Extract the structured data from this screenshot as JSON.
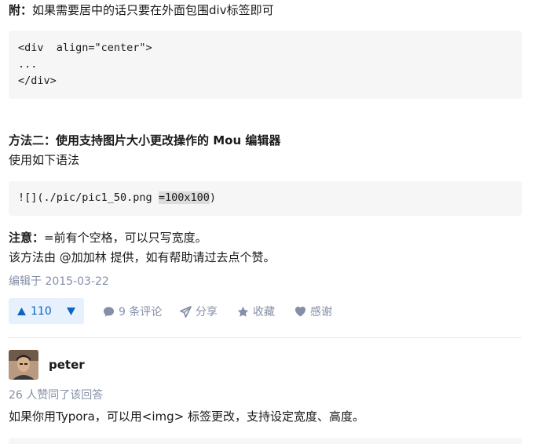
{
  "note1": {
    "label": "附：",
    "text": "如果需要居中的话只要在外面包围div标签即可"
  },
  "code1": {
    "lines": [
      "<div  align=\"center\">",
      "...",
      "</div>"
    ]
  },
  "method2": {
    "title": "方法二：使用支持图片大小更改操作的 Mou 编辑器",
    "subtitle": "使用如下语法"
  },
  "code2": {
    "prefix": "![](./pic/pic1_50.png ",
    "highlight": "=100x100",
    "suffix": ")"
  },
  "note2": {
    "label": "注意：",
    "text": "=前有个空格，可以只写宽度。"
  },
  "credit": {
    "text": "该方法由 @加加林 提供，如有帮助请过去点个赞。"
  },
  "edited": "编辑于 2015-03-22",
  "actions": {
    "upvote_count": "110",
    "comments": "9 条评论",
    "share": "分享",
    "collect": "收藏",
    "thanks": "感谢"
  },
  "answer2": {
    "author": "peter",
    "approvals": "26 人赞同了该回答",
    "text": "如果你用Typora，可以用<img> 标签更改，支持设定宽度、高度。"
  },
  "colors": {
    "accent": "#0a66c2",
    "accent_bg": "#e7f1fd",
    "meta": "#8590a6",
    "code_bg": "#f6f6f6"
  }
}
